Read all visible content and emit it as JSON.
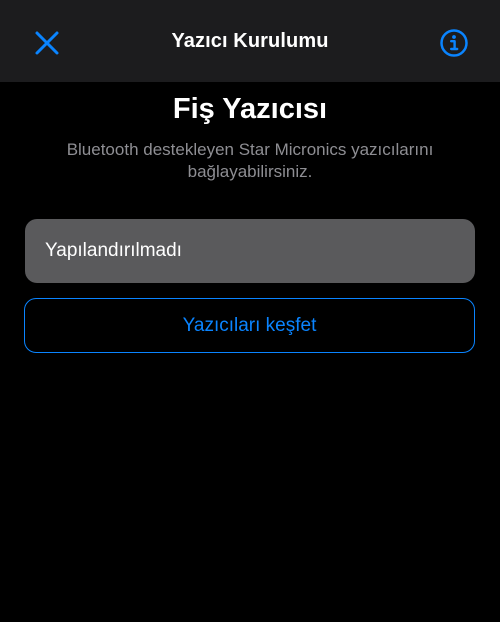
{
  "header": {
    "title": "Yazıcı Kurulumu",
    "close_icon": "close-icon",
    "info_icon": "info-icon"
  },
  "main": {
    "title": "Fiş Yazıcısı",
    "subtitle": "Bluetooth destekleyen Star Micronics yazıcılarını bağlayabilirsiniz.",
    "status_value": "Yapılandırılmadı",
    "discover_label": "Yazıcıları keşfet"
  },
  "colors": {
    "accent": "#0a84ff",
    "background": "#000000",
    "header_background": "#1c1c1e",
    "field_background": "#5a5a5c",
    "secondary_text": "#8e8e93"
  }
}
